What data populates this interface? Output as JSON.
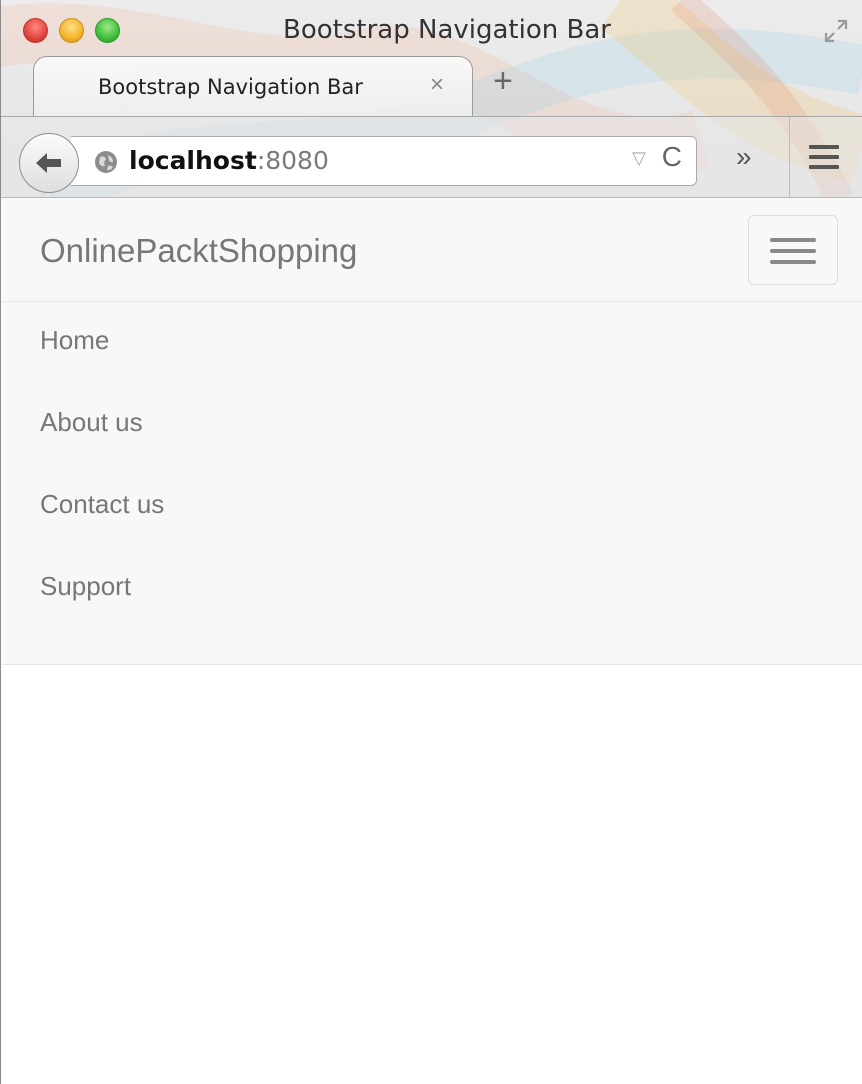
{
  "browser": {
    "window_title": "Bootstrap Navigation Bar",
    "tab_title": "Bootstrap Navigation Bar",
    "tab_close": "×",
    "new_tab": "+",
    "url_host": "localhost",
    "url_port": ":8080",
    "dropmarker": "▽",
    "reload": "C",
    "overflow": "»"
  },
  "navbar": {
    "brand": "OnlinePacktShopping",
    "items": [
      {
        "label": "Home"
      },
      {
        "label": "About us"
      },
      {
        "label": "Contact us"
      },
      {
        "label": "Support"
      }
    ]
  },
  "colors": {
    "navbar_bg": "#f8f8f8",
    "navbar_border": "#e7e7e7",
    "link": "#777777"
  }
}
